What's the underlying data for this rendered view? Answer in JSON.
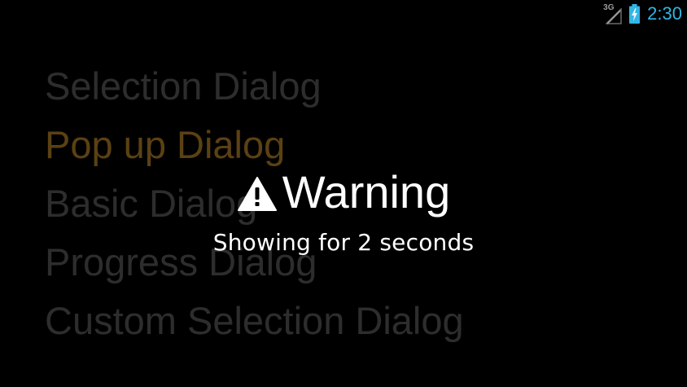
{
  "status_bar": {
    "network": "3G",
    "time": "2:30"
  },
  "list": {
    "items": [
      {
        "label": "Selection Dialog"
      },
      {
        "label": "Pop up Dialog"
      },
      {
        "label": "Basic Dialog"
      },
      {
        "label": "Progress Dialog"
      },
      {
        "label": "Custom Selection Dialog"
      }
    ]
  },
  "toast": {
    "icon": "warning-icon",
    "title": "Warning",
    "message": "Showing for 2 seconds"
  }
}
